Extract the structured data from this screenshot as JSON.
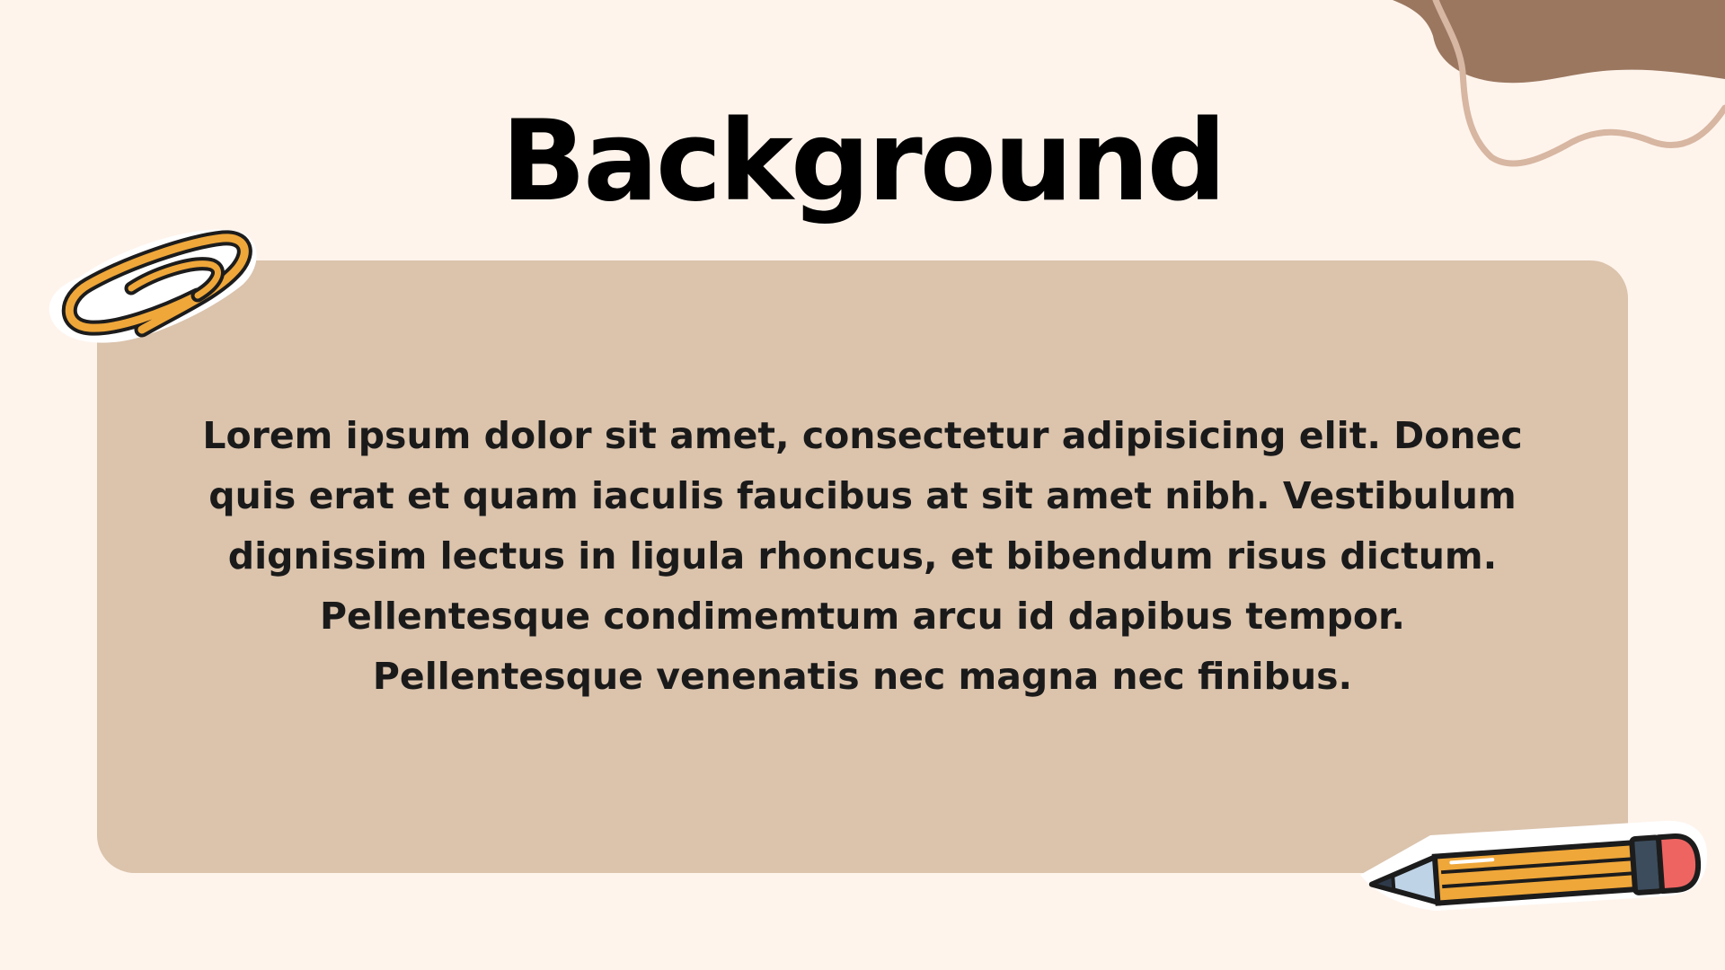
{
  "slide": {
    "title": "Background",
    "body": "Lorem ipsum dolor sit amet, consectetur adipisicing elit. Donec quis erat et quam iaculis faucibus at sit amet nibh. Vestibulum dignissim lectus in ligula rhoncus, et bibendum risus dictum. Pellentesque condimemtum arcu id dapibus tempor. Pellentesque venenatis nec magna nec finibus."
  },
  "colors": {
    "background": "#FEF4EC",
    "card": "#DBC3AC",
    "blob": "#9B7760",
    "blob_outline": "#D7B6A2",
    "text": "#000000"
  },
  "decorations": {
    "top_right": "brown-blob-shape",
    "top_left": "paperclip-icon",
    "bottom_right": "pencil-icon"
  }
}
